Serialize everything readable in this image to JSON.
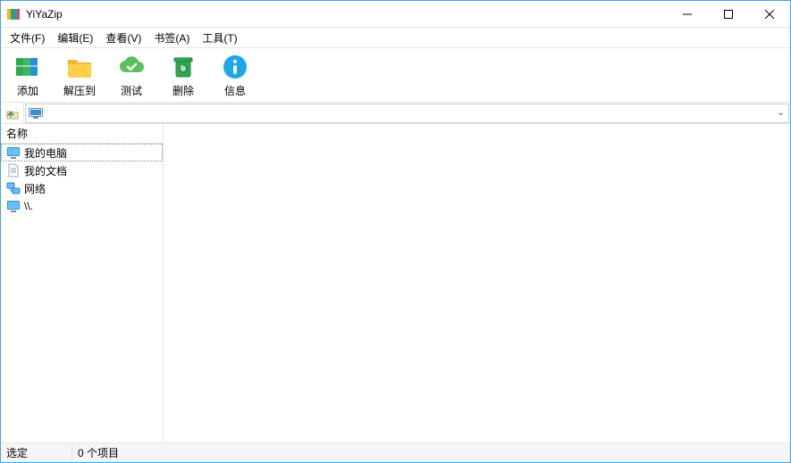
{
  "title": "YiYaZip",
  "menu": {
    "file": "文件(F)",
    "edit": "编辑(E)",
    "view": "查看(V)",
    "bookmark": "书签(A)",
    "tools": "工具(T)"
  },
  "toolbar": {
    "add": "添加",
    "extract": "解压到",
    "test": "测试",
    "delete": "删除",
    "info": "信息"
  },
  "path": "",
  "list": {
    "header_name": "名称",
    "items": [
      {
        "label": "我的电脑",
        "icon": "monitor"
      },
      {
        "label": "我的文档",
        "icon": "doc"
      },
      {
        "label": "网络",
        "icon": "network"
      },
      {
        "label": "\\\\.",
        "icon": "monitor"
      }
    ]
  },
  "status": {
    "selected_label": "选定",
    "count_text": "0 个项目"
  }
}
